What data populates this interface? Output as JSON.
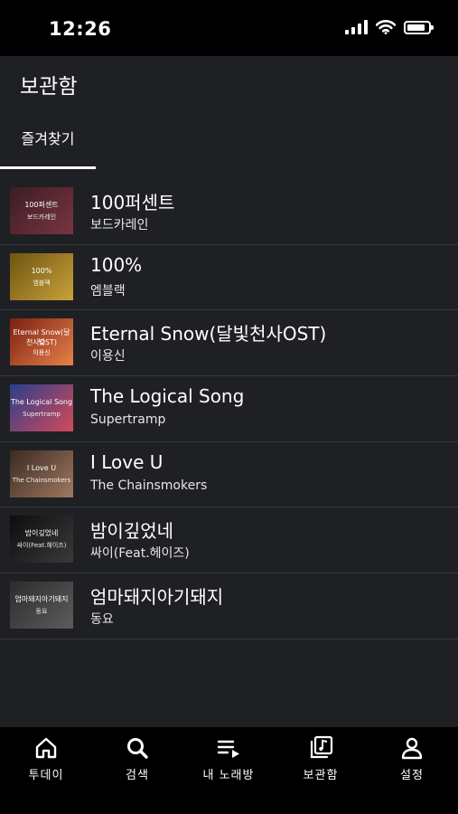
{
  "status": {
    "time": "12:26",
    "battery_level": 0.85
  },
  "header": {
    "title": "보관함"
  },
  "tabs": [
    {
      "label": "즐겨찾기",
      "active": true
    }
  ],
  "songs": [
    {
      "title": "100퍼센트",
      "artist": "보드카레인",
      "cover_line1": "100퍼센트",
      "cover_line2": "보드카레인",
      "cover_colors": [
        "#3b1e26",
        "#7a3440"
      ]
    },
    {
      "title": "100%",
      "artist": "엠블랙",
      "cover_line1": "100%",
      "cover_line2": "엠블랙",
      "cover_colors": [
        "#6e5410",
        "#c9a23a"
      ]
    },
    {
      "title": "Eternal Snow(달빛천사OST)",
      "artist": "이용신",
      "cover_line1": "Eternal Snow(달빛",
      "cover_line2": "천사OST)",
      "cover_line3": "이용신",
      "cover_colors": [
        "#7a1f12",
        "#e8824a"
      ]
    },
    {
      "title": "The Logical Song",
      "artist": "Supertramp",
      "cover_line1": "The Logical Song",
      "cover_line2": "Supertramp",
      "cover_colors": [
        "#2a3f8a",
        "#d44a5a"
      ]
    },
    {
      "title": "I Love U",
      "artist": "The Chainsmokers",
      "cover_line1": "I Love U",
      "cover_line2": "The Chainsmokers",
      "cover_colors": [
        "#3a2a22",
        "#a07860"
      ]
    },
    {
      "title": "밤이깊었네",
      "artist": "싸이(Feat.헤이즈)",
      "cover_line1": "밤이깊었네",
      "cover_line2": "싸이(Feat.헤이즈)",
      "cover_colors": [
        "#0d0d0d",
        "#3a3a3a"
      ]
    },
    {
      "title": "엄마돼지아기돼지",
      "artist": "동요",
      "cover_line1": "엄마돼지아기돼지",
      "cover_line2": "동요",
      "cover_colors": [
        "#2c2c2c",
        "#5c5c5c"
      ]
    }
  ],
  "bottom_nav": [
    {
      "label": "투데이",
      "icon": "home-icon"
    },
    {
      "label": "검색",
      "icon": "search-icon"
    },
    {
      "label": "내 노래방",
      "icon": "playlist-icon"
    },
    {
      "label": "보관함",
      "icon": "library-icon"
    },
    {
      "label": "설정",
      "icon": "person-icon"
    }
  ]
}
